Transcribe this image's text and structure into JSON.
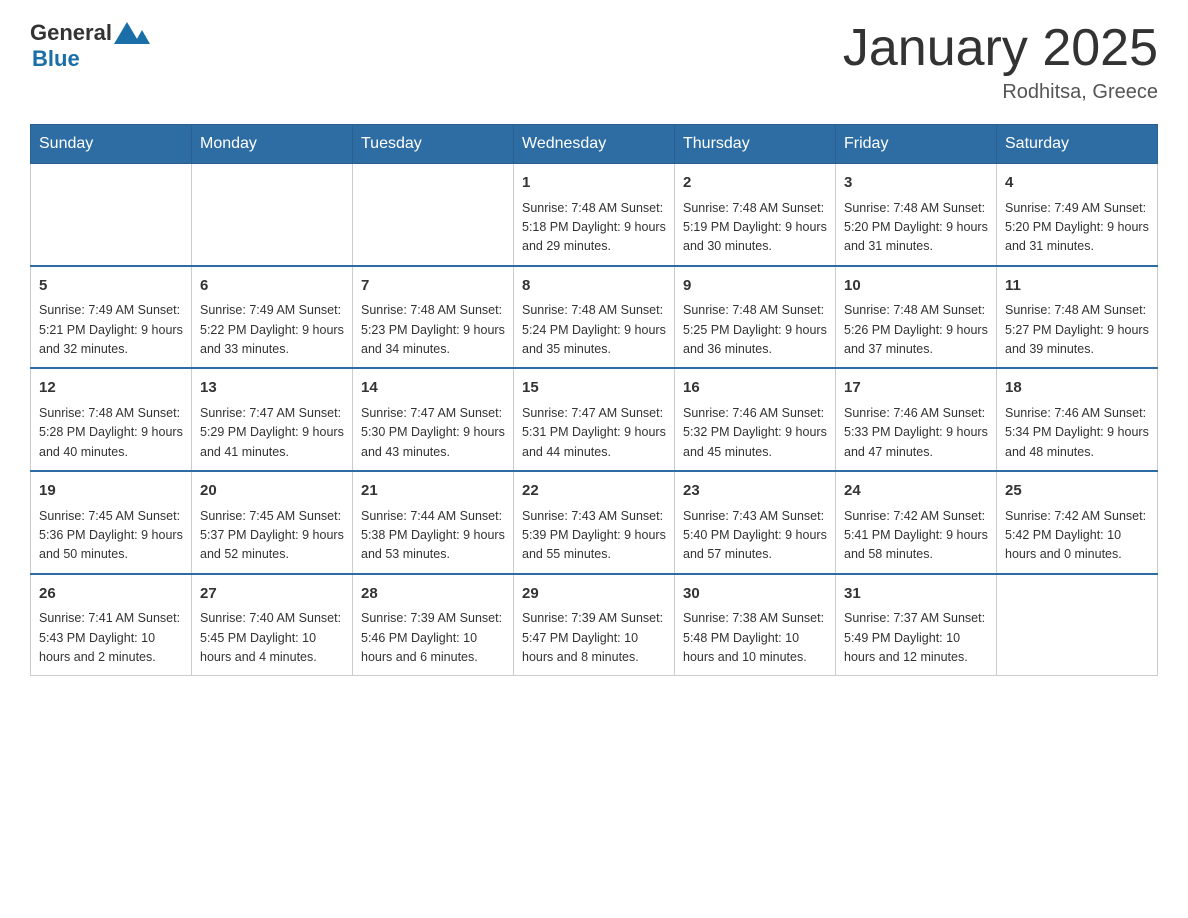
{
  "header": {
    "logo_general": "General",
    "logo_blue": "Blue",
    "title": "January 2025",
    "subtitle": "Rodhitsa, Greece"
  },
  "days_of_week": [
    "Sunday",
    "Monday",
    "Tuesday",
    "Wednesday",
    "Thursday",
    "Friday",
    "Saturday"
  ],
  "weeks": [
    {
      "days": [
        {
          "number": "",
          "info": ""
        },
        {
          "number": "",
          "info": ""
        },
        {
          "number": "",
          "info": ""
        },
        {
          "number": "1",
          "info": "Sunrise: 7:48 AM\nSunset: 5:18 PM\nDaylight: 9 hours\nand 29 minutes."
        },
        {
          "number": "2",
          "info": "Sunrise: 7:48 AM\nSunset: 5:19 PM\nDaylight: 9 hours\nand 30 minutes."
        },
        {
          "number": "3",
          "info": "Sunrise: 7:48 AM\nSunset: 5:20 PM\nDaylight: 9 hours\nand 31 minutes."
        },
        {
          "number": "4",
          "info": "Sunrise: 7:49 AM\nSunset: 5:20 PM\nDaylight: 9 hours\nand 31 minutes."
        }
      ]
    },
    {
      "days": [
        {
          "number": "5",
          "info": "Sunrise: 7:49 AM\nSunset: 5:21 PM\nDaylight: 9 hours\nand 32 minutes."
        },
        {
          "number": "6",
          "info": "Sunrise: 7:49 AM\nSunset: 5:22 PM\nDaylight: 9 hours\nand 33 minutes."
        },
        {
          "number": "7",
          "info": "Sunrise: 7:48 AM\nSunset: 5:23 PM\nDaylight: 9 hours\nand 34 minutes."
        },
        {
          "number": "8",
          "info": "Sunrise: 7:48 AM\nSunset: 5:24 PM\nDaylight: 9 hours\nand 35 minutes."
        },
        {
          "number": "9",
          "info": "Sunrise: 7:48 AM\nSunset: 5:25 PM\nDaylight: 9 hours\nand 36 minutes."
        },
        {
          "number": "10",
          "info": "Sunrise: 7:48 AM\nSunset: 5:26 PM\nDaylight: 9 hours\nand 37 minutes."
        },
        {
          "number": "11",
          "info": "Sunrise: 7:48 AM\nSunset: 5:27 PM\nDaylight: 9 hours\nand 39 minutes."
        }
      ]
    },
    {
      "days": [
        {
          "number": "12",
          "info": "Sunrise: 7:48 AM\nSunset: 5:28 PM\nDaylight: 9 hours\nand 40 minutes."
        },
        {
          "number": "13",
          "info": "Sunrise: 7:47 AM\nSunset: 5:29 PM\nDaylight: 9 hours\nand 41 minutes."
        },
        {
          "number": "14",
          "info": "Sunrise: 7:47 AM\nSunset: 5:30 PM\nDaylight: 9 hours\nand 43 minutes."
        },
        {
          "number": "15",
          "info": "Sunrise: 7:47 AM\nSunset: 5:31 PM\nDaylight: 9 hours\nand 44 minutes."
        },
        {
          "number": "16",
          "info": "Sunrise: 7:46 AM\nSunset: 5:32 PM\nDaylight: 9 hours\nand 45 minutes."
        },
        {
          "number": "17",
          "info": "Sunrise: 7:46 AM\nSunset: 5:33 PM\nDaylight: 9 hours\nand 47 minutes."
        },
        {
          "number": "18",
          "info": "Sunrise: 7:46 AM\nSunset: 5:34 PM\nDaylight: 9 hours\nand 48 minutes."
        }
      ]
    },
    {
      "days": [
        {
          "number": "19",
          "info": "Sunrise: 7:45 AM\nSunset: 5:36 PM\nDaylight: 9 hours\nand 50 minutes."
        },
        {
          "number": "20",
          "info": "Sunrise: 7:45 AM\nSunset: 5:37 PM\nDaylight: 9 hours\nand 52 minutes."
        },
        {
          "number": "21",
          "info": "Sunrise: 7:44 AM\nSunset: 5:38 PM\nDaylight: 9 hours\nand 53 minutes."
        },
        {
          "number": "22",
          "info": "Sunrise: 7:43 AM\nSunset: 5:39 PM\nDaylight: 9 hours\nand 55 minutes."
        },
        {
          "number": "23",
          "info": "Sunrise: 7:43 AM\nSunset: 5:40 PM\nDaylight: 9 hours\nand 57 minutes."
        },
        {
          "number": "24",
          "info": "Sunrise: 7:42 AM\nSunset: 5:41 PM\nDaylight: 9 hours\nand 58 minutes."
        },
        {
          "number": "25",
          "info": "Sunrise: 7:42 AM\nSunset: 5:42 PM\nDaylight: 10 hours\nand 0 minutes."
        }
      ]
    },
    {
      "days": [
        {
          "number": "26",
          "info": "Sunrise: 7:41 AM\nSunset: 5:43 PM\nDaylight: 10 hours\nand 2 minutes."
        },
        {
          "number": "27",
          "info": "Sunrise: 7:40 AM\nSunset: 5:45 PM\nDaylight: 10 hours\nand 4 minutes."
        },
        {
          "number": "28",
          "info": "Sunrise: 7:39 AM\nSunset: 5:46 PM\nDaylight: 10 hours\nand 6 minutes."
        },
        {
          "number": "29",
          "info": "Sunrise: 7:39 AM\nSunset: 5:47 PM\nDaylight: 10 hours\nand 8 minutes."
        },
        {
          "number": "30",
          "info": "Sunrise: 7:38 AM\nSunset: 5:48 PM\nDaylight: 10 hours\nand 10 minutes."
        },
        {
          "number": "31",
          "info": "Sunrise: 7:37 AM\nSunset: 5:49 PM\nDaylight: 10 hours\nand 12 minutes."
        },
        {
          "number": "",
          "info": ""
        }
      ]
    }
  ]
}
